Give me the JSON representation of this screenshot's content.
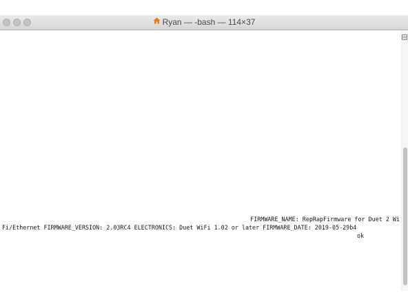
{
  "window": {
    "title": "Ryan — -bash — 114×37"
  },
  "terminal": {
    "lines": [
      "FIRMWARE_NAME: RepRapFirmware for Duet 2 Wi",
      "Fi/Ethernet FIRMWARE_VERSION: 2.03RC4 ELECTRONICS: Duet WiFi 1.02 or later FIRMWARE_DATE: 2019-05-29b4",
      "ok"
    ]
  },
  "icons": {
    "home": "home-icon",
    "split": "split-pane-icon"
  },
  "colors": {
    "home_icon": "#d9822b",
    "traffic_light": "#c3c3c3",
    "text": "#1a1a1a"
  }
}
